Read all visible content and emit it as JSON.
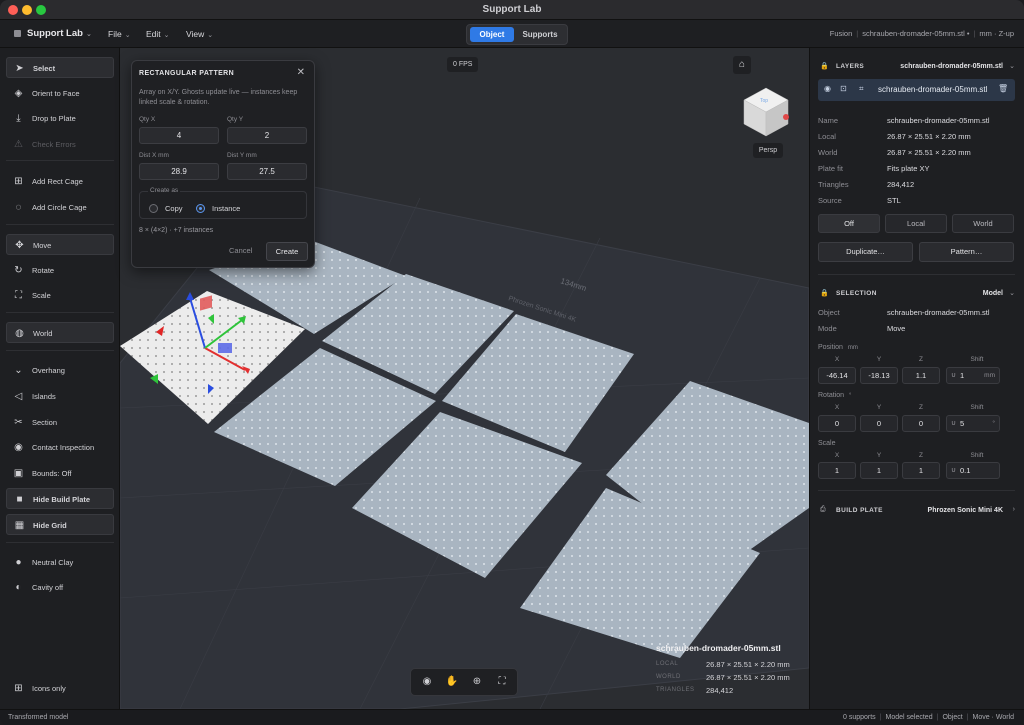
{
  "window": {
    "title": "Support Lab"
  },
  "menubar": {
    "brand": "Support Lab",
    "menus": [
      "File",
      "Edit",
      "View"
    ],
    "modes": [
      "Object",
      "Supports"
    ],
    "crumbs": [
      "Fusion",
      "schrauben-dromader-05mm.stl •",
      "mm · Z-up"
    ]
  },
  "tools": {
    "select": "Select",
    "orient": "Orient to Face",
    "drop": "Drop to Plate",
    "check": "Check Errors",
    "rect_cage": "Add Rect Cage",
    "circle_cage": "Add Circle Cage",
    "move": "Move",
    "rotate": "Rotate",
    "scale": "Scale",
    "world": "World",
    "overhang": "Overhang",
    "islands": "Islands",
    "section": "Section",
    "contact": "Contact Inspection",
    "bounds": "Bounds: Off",
    "hide_plate": "Hide Build Plate",
    "hide_grid": "Hide Grid",
    "clay": "Neutral Clay",
    "cavity": "Cavity off",
    "icons_only": "Icons only"
  },
  "viewport": {
    "fps": "0 FPS",
    "persp": "Persp",
    "dimension_label": "134mm",
    "plate_label": "Phrozen Sonic Mini 4K",
    "cube_label": "Top",
    "info": {
      "name": "schrauben-dromader-05mm.stl",
      "rows": [
        {
          "k": "LOCAL",
          "v": "26.87 × 25.51 × 2.20 mm"
        },
        {
          "k": "WORLD",
          "v": "26.87 × 25.51 × 2.20 mm"
        },
        {
          "k": "TRIANGLES",
          "v": "284,412"
        }
      ]
    }
  },
  "dialog": {
    "title": "RECTANGULAR PATTERN",
    "desc": "Array on X/Y. Ghosts update live — instances keep linked scale & rotation.",
    "qty_x_label": "Qty X",
    "qty_x": "4",
    "qty_y_label": "Qty Y",
    "qty_y": "2",
    "dist_x_label": "Dist X mm",
    "dist_x": "28.9",
    "dist_y_label": "Dist Y mm",
    "dist_y": "27.5",
    "create_as": "Create as",
    "copy": "Copy",
    "instance": "Instance",
    "count": "8 × (4×2) · +7 instances",
    "cancel": "Cancel",
    "create": "Create"
  },
  "layers": {
    "title": "LAYERS",
    "file": "schrauben-dromader-05mm.stl",
    "row_name": "schrauben-dromader-05mm.stl",
    "props": [
      {
        "k": "Name",
        "v": "schrauben-dromader-05mm.stl"
      },
      {
        "k": "Local",
        "v": "26.87 × 25.51 × 2.20 mm"
      },
      {
        "k": "World",
        "v": "26.87 × 25.51 × 2.20 mm"
      },
      {
        "k": "Plate fit",
        "v": "Fits plate XY"
      },
      {
        "k": "Triangles",
        "v": "284,412"
      },
      {
        "k": "Source",
        "v": "STL"
      }
    ],
    "space": [
      "Off",
      "Local",
      "World"
    ],
    "duplicate": "Duplicate…",
    "pattern": "Pattern…"
  },
  "selection": {
    "title": "SELECTION",
    "mode_value": "Model",
    "object_k": "Object",
    "object_v": "schrauben-dromader-05mm.stl",
    "mode_k": "Mode",
    "mode_v": "Move",
    "position_label": "Position",
    "position_unit": "mm",
    "rotation_label": "Rotation",
    "rotation_unit": "°",
    "scale_label": "Scale",
    "cols": [
      "X",
      "Y",
      "Z",
      "Shift"
    ],
    "position": [
      "-46.14",
      "-18.13",
      "1.1"
    ],
    "position_shift": "1",
    "position_shift_unit": "mm",
    "rotation": [
      "0",
      "0",
      "0"
    ],
    "rotation_shift": "5",
    "rotation_shift_unit": "°",
    "scale": [
      "1",
      "1",
      "1"
    ],
    "scale_shift": "0.1"
  },
  "build_plate": {
    "title": "BUILD PLATE",
    "value": "Phrozen Sonic Mini 4K"
  },
  "status": {
    "left": "Transformed model",
    "right": [
      "0 supports",
      "Model selected",
      "Object",
      "Move · World"
    ]
  }
}
